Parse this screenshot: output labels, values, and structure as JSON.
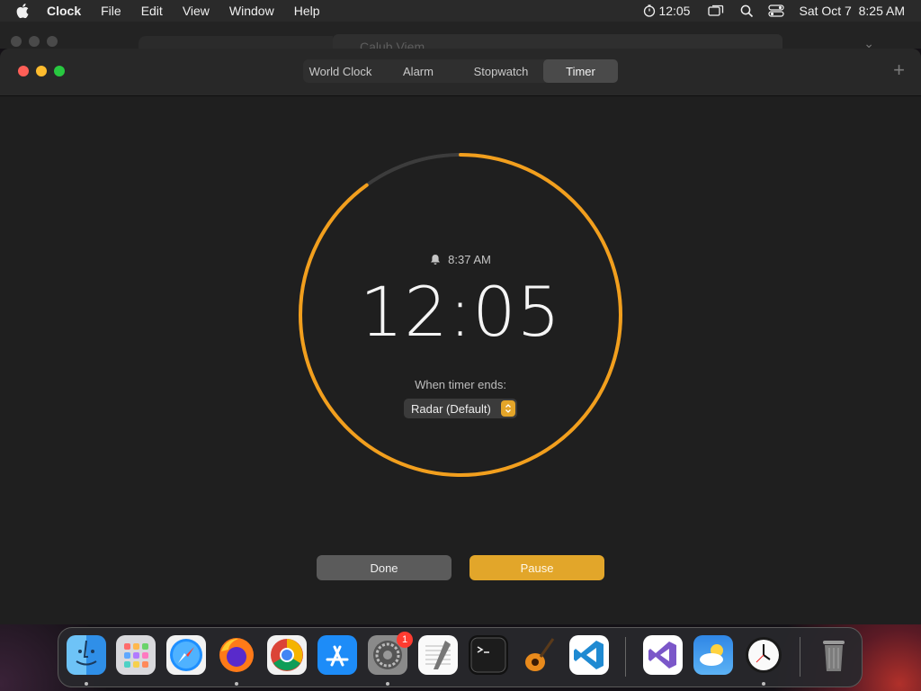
{
  "menubar": {
    "app_name": "Clock",
    "menus": [
      "File",
      "Edit",
      "View",
      "Window",
      "Help"
    ],
    "timer_status": "12:05",
    "datetime": "Sat Oct 7  8:25 AM"
  },
  "background_window": {
    "title": "Calub Viem"
  },
  "tabs": [
    "World Clock",
    "Alarm",
    "Stopwatch",
    "Timer"
  ],
  "active_tab": "Timer",
  "timer": {
    "alarm_time": "8:37 AM",
    "remaining": "12:05",
    "ends_label": "When timer ends:",
    "sound": "Radar (Default)",
    "progress_remaining_fraction": 0.9,
    "ring_color": "#f29f1d"
  },
  "buttons": {
    "done": "Done",
    "pause": "Pause"
  },
  "dock": {
    "apps": [
      "Finder",
      "Launchpad",
      "Safari",
      "Firefox",
      "Chrome",
      "App Store",
      "System Settings",
      "TextEdit",
      "Terminal",
      "GarageBand",
      "VS Code",
      "Visual Studio",
      "Weather",
      "Clock",
      "Trash"
    ],
    "settings_badge": "1"
  }
}
